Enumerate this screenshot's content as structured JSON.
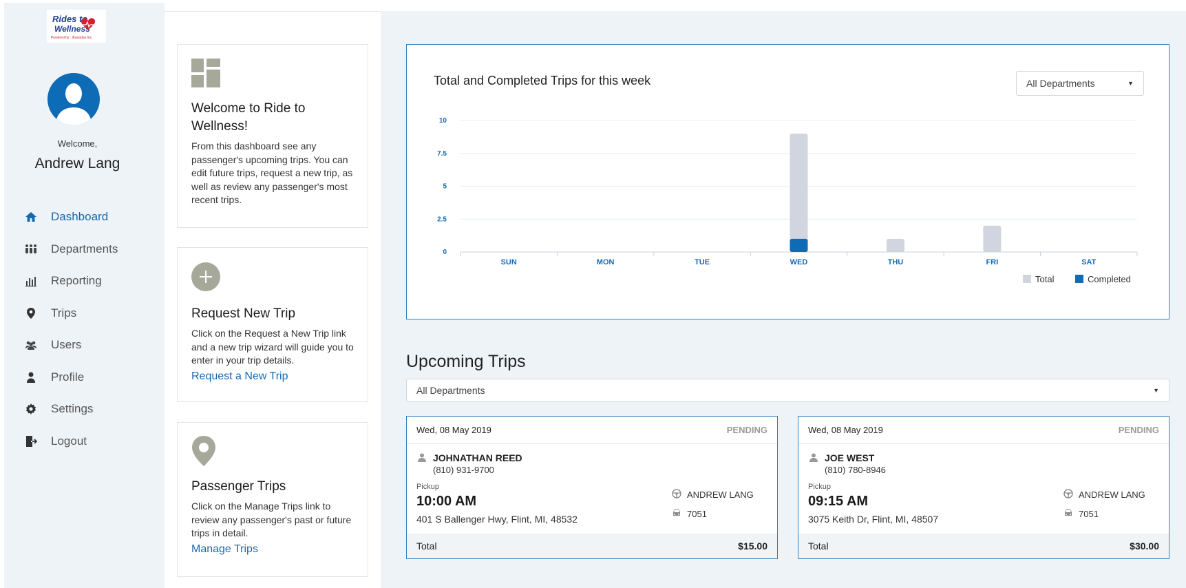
{
  "logo": {
    "line1": "Rides to",
    "line2": "Wellness",
    "tagline": "Powered by : iKavadya Inc."
  },
  "user": {
    "welcome": "Welcome,",
    "name": "Andrew Lang"
  },
  "nav": [
    {
      "label": "Dashboard",
      "icon": "home-icon",
      "active": true
    },
    {
      "label": "Departments",
      "icon": "group-icon"
    },
    {
      "label": "Reporting",
      "icon": "bar-chart-icon"
    },
    {
      "label": "Trips",
      "icon": "map-pin-icon"
    },
    {
      "label": "Users",
      "icon": "users-icon"
    },
    {
      "label": "Profile",
      "icon": "person-icon"
    },
    {
      "label": "Settings",
      "icon": "gear-icon"
    },
    {
      "label": "Logout",
      "icon": "logout-icon"
    }
  ],
  "cards": {
    "welcome": {
      "title": "Welcome to Ride to Wellness!",
      "text": "From this dashboard see any passenger's upcoming trips. You can edit future trips, request a new trip, as well as review any passenger's most recent trips."
    },
    "request": {
      "title": "Request New Trip",
      "text": "Click on the Request a New Trip link and a new trip wizard will guide you to enter in your trip details.",
      "link": "Request a New Trip"
    },
    "passenger": {
      "title": "Passenger Trips",
      "text": "Click on the Manage Trips link to review any passenger's past or future trips in detail.",
      "link": "Manage Trips"
    }
  },
  "chart_panel": {
    "select_value": "All Departments"
  },
  "chart_data": {
    "type": "bar",
    "title": "Total and Completed Trips for this week",
    "categories": [
      "SUN",
      "MON",
      "TUE",
      "WED",
      "THU",
      "FRI",
      "SAT"
    ],
    "series": [
      {
        "name": "Total",
        "values": [
          0,
          0,
          0,
          9,
          1,
          2,
          0
        ],
        "color": "#d1d5e0"
      },
      {
        "name": "Completed",
        "values": [
          0,
          0,
          0,
          1,
          0,
          0,
          0
        ],
        "color": "#0e6bb5"
      }
    ],
    "ylim": [
      0,
      10
    ],
    "yticks": [
      "0",
      "2.5",
      "5",
      "7.5",
      "10"
    ],
    "ytick_values": [
      0,
      2.5,
      5,
      7.5,
      10
    ],
    "grid": true,
    "legend": "bottom-right"
  },
  "upcoming": {
    "title": "Upcoming Trips",
    "select_value": "All Departments",
    "trips": [
      {
        "date": "Wed, 08 May 2019",
        "status": "PENDING",
        "name": "JOHNATHAN REED",
        "phone": "(810) 931-9700",
        "pickup_label": "Pickup",
        "time": "10:00 AM",
        "address": "401 S Ballenger Hwy, Flint, MI, 48532",
        "driver": "ANDREW LANG",
        "vehicle": "7051",
        "total_label": "Total",
        "total": "$15.00"
      },
      {
        "date": "Wed, 08 May 2019",
        "status": "PENDING",
        "name": "JOE WEST",
        "phone": "(810) 780-8946",
        "pickup_label": "Pickup",
        "time": "09:15 AM",
        "address": "3075 Keith Dr, Flint, MI, 48507",
        "driver": "ANDREW LANG",
        "vehicle": "7051",
        "total_label": "Total",
        "total": "$30.00"
      }
    ]
  }
}
